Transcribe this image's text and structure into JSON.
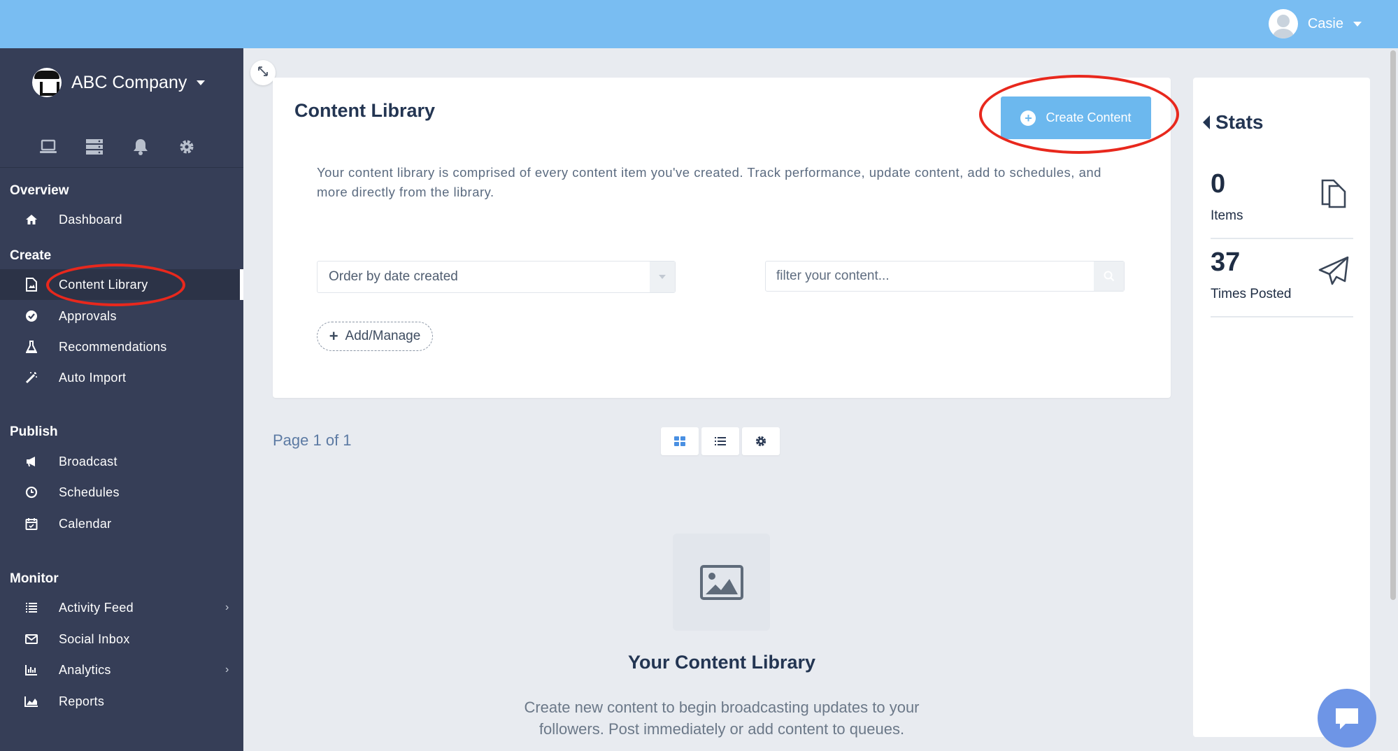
{
  "topbar": {
    "user_name": "Casie"
  },
  "sidebar": {
    "company_name": "ABC Company",
    "sections": {
      "overview": "Overview",
      "create": "Create",
      "publish": "Publish",
      "monitor": "Monitor"
    },
    "items": {
      "dashboard": "Dashboard",
      "content_library": "Content Library",
      "approvals": "Approvals",
      "recommendations": "Recommendations",
      "auto_import": "Auto Import",
      "broadcast": "Broadcast",
      "schedules": "Schedules",
      "calendar": "Calendar",
      "activity_feed": "Activity Feed",
      "social_inbox": "Social Inbox",
      "analytics": "Analytics",
      "reports": "Reports"
    }
  },
  "main": {
    "title": "Content Library",
    "create_button": "Create Content",
    "description": "Your content library is comprised of every content item you've created. Track performance, update content, add to schedules, and more directly from the library.",
    "order_select": "Order by date created",
    "filter_placeholder": "filter your content...",
    "add_manage": "Add/Manage",
    "page_info": "Page 1 of 1",
    "empty_title": "Your Content Library",
    "empty_text": "Create new content to begin broadcasting updates to your followers. Post immediately or add content to queues."
  },
  "stats": {
    "title": "Stats",
    "items_count": "0",
    "items_label": "Items",
    "times_posted_count": "37",
    "times_posted_label": "Times Posted"
  },
  "colors": {
    "topbar": "#79bdf2",
    "sidebar": "#363e57",
    "accent": "#6cb8ee",
    "annotation": "#e8281d"
  }
}
